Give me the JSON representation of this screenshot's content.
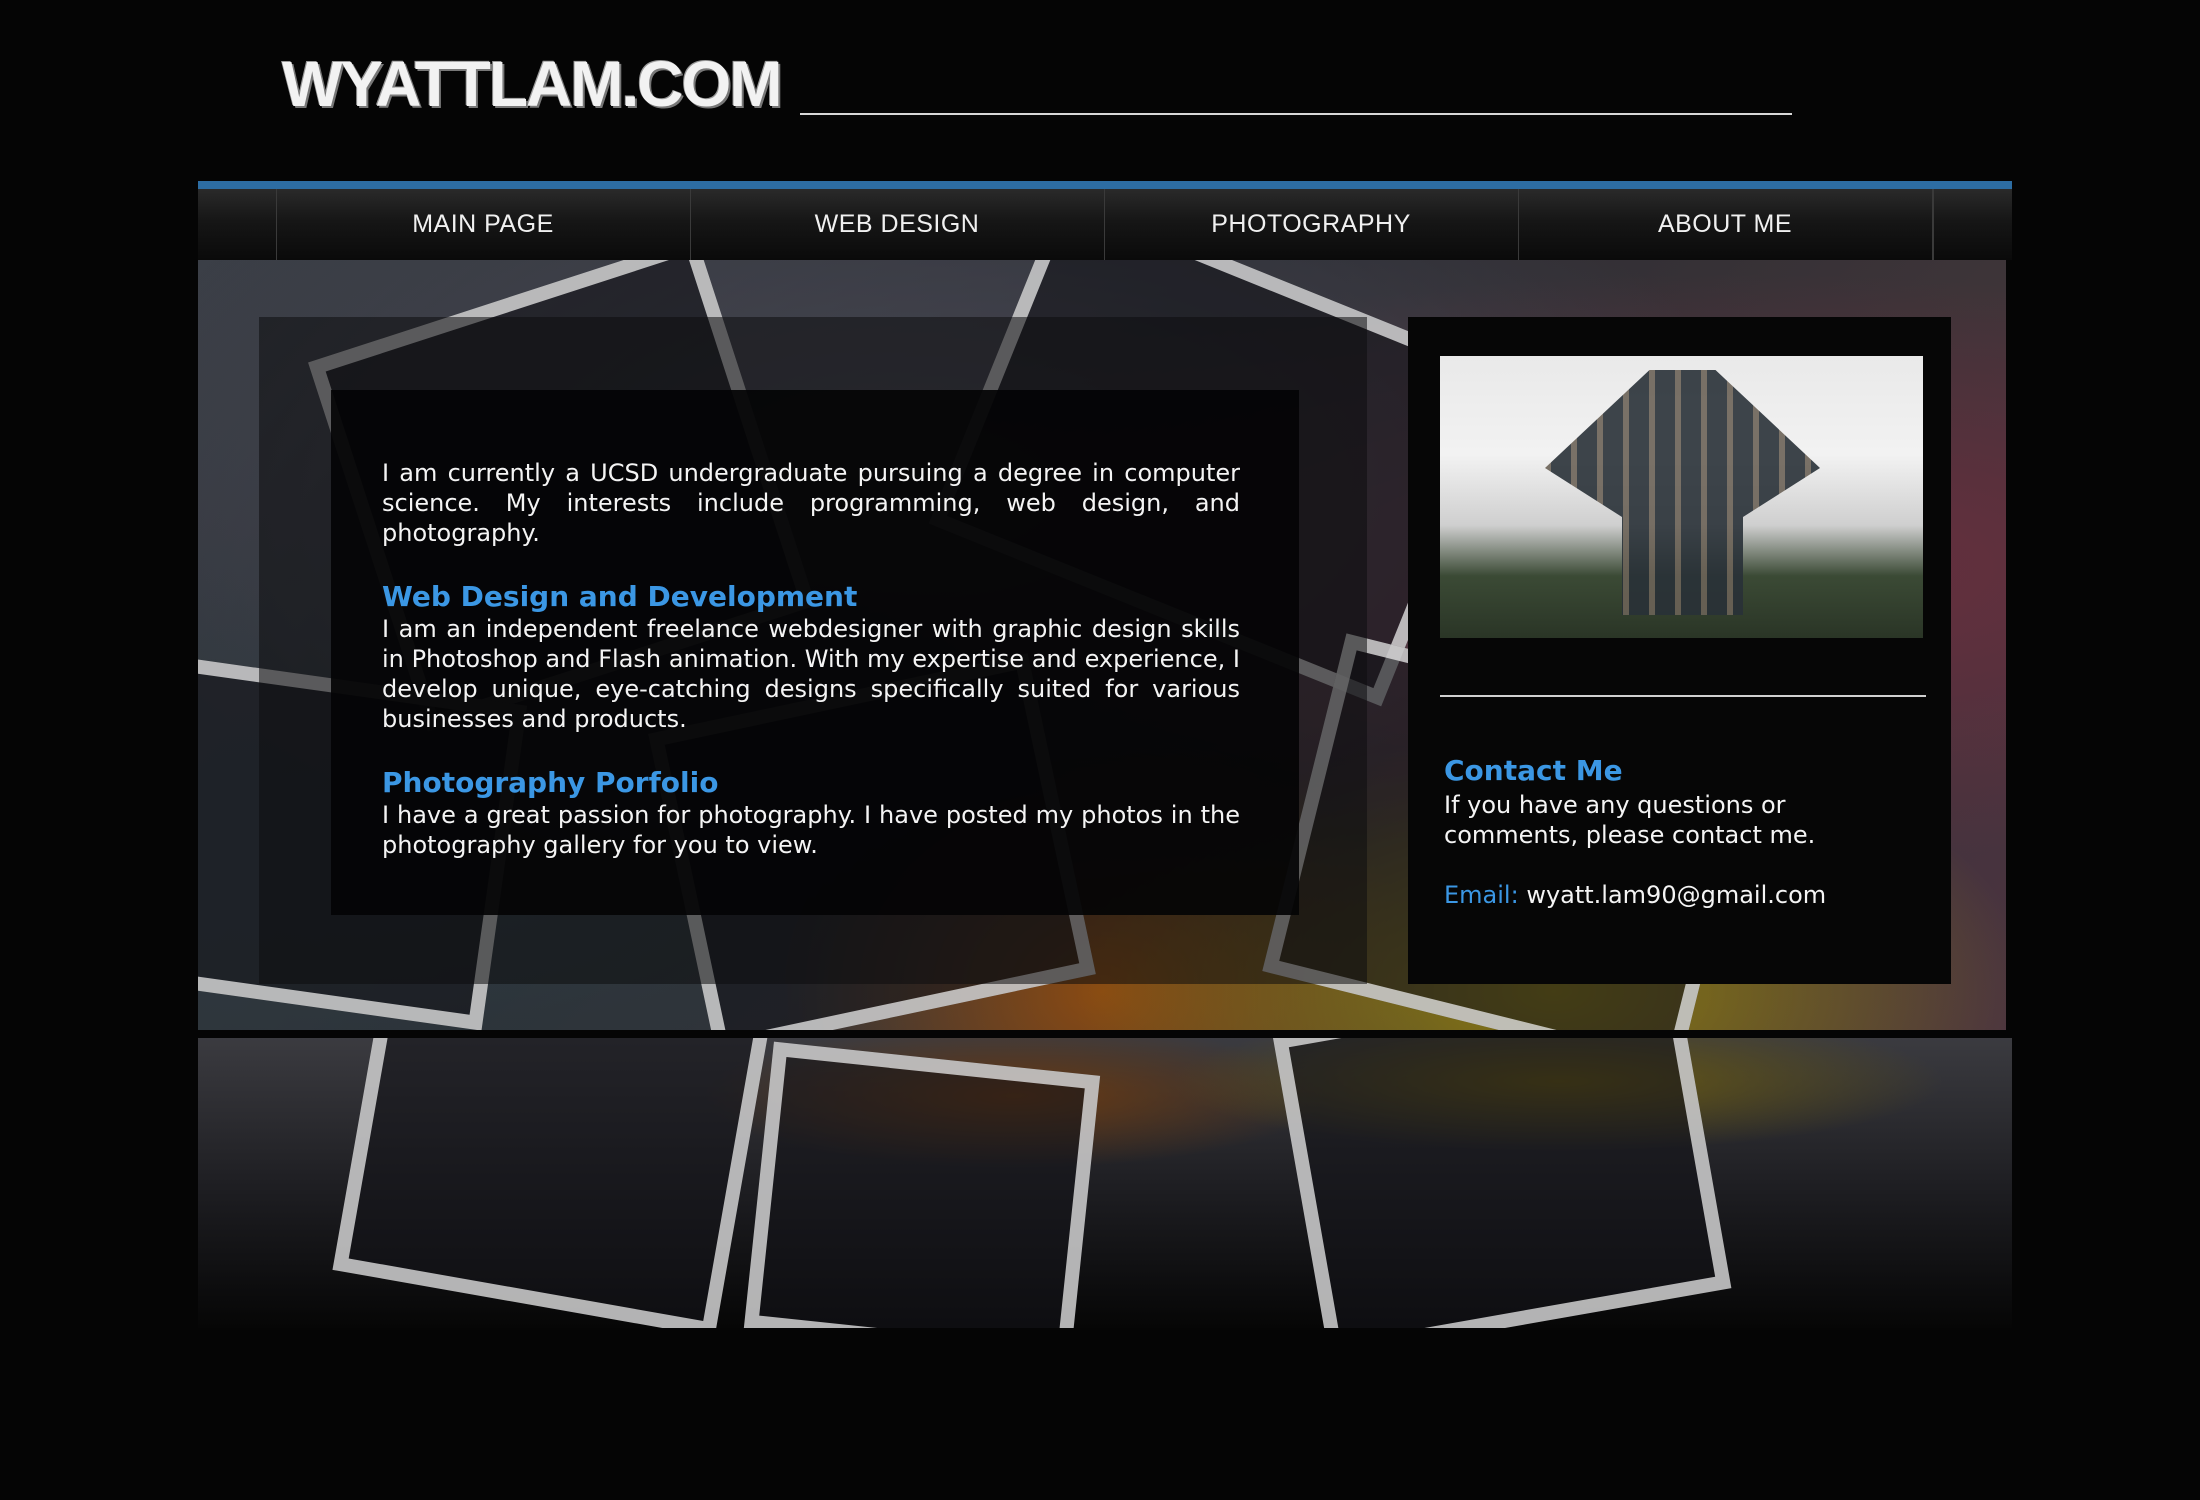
{
  "header": {
    "logo_text": "WYATTLAM.COM"
  },
  "nav": {
    "items": [
      {
        "label": "MAIN PAGE"
      },
      {
        "label": "WEB DESIGN"
      },
      {
        "label": "PHOTOGRAPHY"
      },
      {
        "label": "ABOUT ME"
      }
    ]
  },
  "main": {
    "intro": "I am currently a UCSD undergraduate pursuing a degree in computer science.  My interests include programming, web design, and photography.",
    "sections": [
      {
        "heading": "Web Design and Development",
        "body": "I am an independent freelance webdesigner with graphic design skills in Photoshop and Flash animation. With my expertise and experience, I  develop unique, eye-catching designs specifically suited for various businesses and products."
      },
      {
        "heading": "Photography Porfolio",
        "body": "I have a great passion for photography. I have posted my photos in the photography gallery for you to view."
      }
    ]
  },
  "sidebar": {
    "contact_title": "Contact Me",
    "contact_text": "If you have any questions or comments, please contact me.",
    "email_label": "Email:",
    "email_value": "wyatt.lam90@gmail.com"
  },
  "colors": {
    "accent": "#3b97e4",
    "nav_top_bar": "#2d6da3",
    "background": "#050505"
  }
}
